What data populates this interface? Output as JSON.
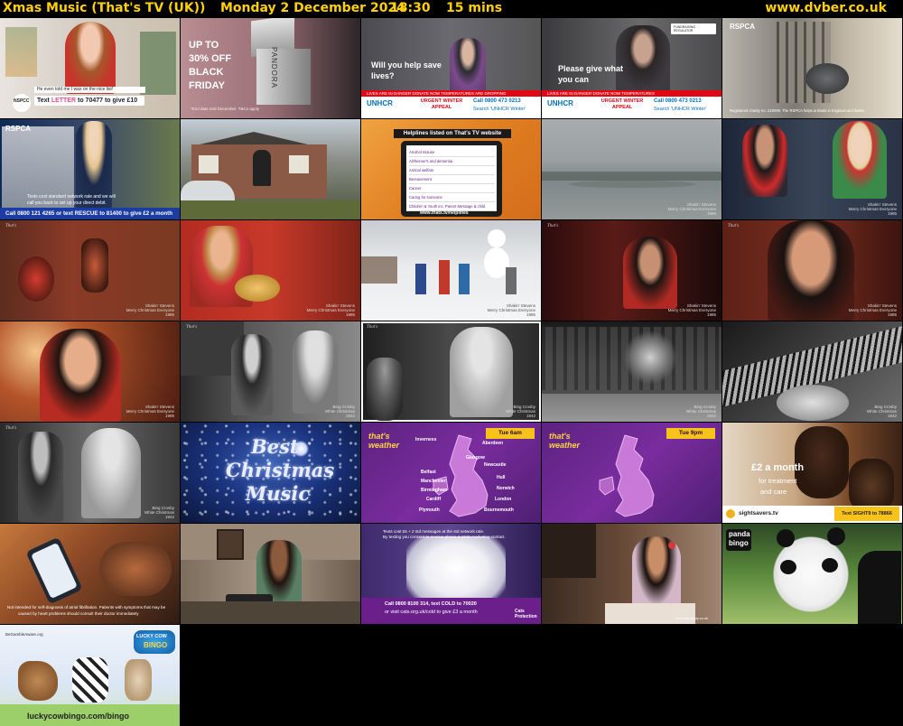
{
  "header": {
    "channel_title": "Xmas Music (That's TV (UK))",
    "date": "Monday 2 December 2024",
    "time": "18:30",
    "duration": "15 mins",
    "site": "www.dvber.co.uk"
  },
  "tiles": [
    {
      "id": "t01",
      "scene": "nrns-charity-ad",
      "texts": {
        "caption": "He even told me I was on the nice list!",
        "cta_pre": "Text ",
        "cta_key": "LETTER",
        "cta_mid": " to 70477 to give £10",
        "logo": "NSPCC"
      }
    },
    {
      "id": "t02",
      "scene": "pandora-black-friday",
      "texts": {
        "line1": "UP TO",
        "line2": "30% OFF",
        "line3": "BLACK",
        "line4": "FRIDAY",
        "brand": "PANDORA",
        "fine": "*End date 2nd December. T&Cs apply"
      }
    },
    {
      "id": "t03",
      "scene": "unhcr-appeal-girl",
      "texts": {
        "question": "Will you help save lives?",
        "ticker": "LIVES ARE IN DANGER   DONATE NOW   TEMPERATURES ARE DROPPING",
        "org": "UNHCR",
        "appeal": "URGENT WINTER APPEAL",
        "phone": "Call 0800 473 0213",
        "search": "Search 'UNHCR Winter'"
      }
    },
    {
      "id": "t04",
      "scene": "unhcr-appeal-boy",
      "texts": {
        "question": "Please give what you can",
        "ticker": "LIVES ARE IN DANGER   DONATE NOW   TEMPERATURES",
        "org": "UNHCR",
        "appeal": "URGENT WINTER APPEAL",
        "phone": "Call 0800 473 0213",
        "search": "Search 'UNHCR Winter'",
        "badge": "FUNDRAISING REGULATOR"
      }
    },
    {
      "id": "t05",
      "scene": "rspca-kennel",
      "texts": {
        "logo": "RSPCA",
        "fine": "Registered charity no. 219099. The RSPCA helps animals in England and Wales"
      }
    },
    {
      "id": "t06",
      "scene": "rspca-van",
      "texts": {
        "logo": "RSPCA",
        "small1": "Texts cost standard network rate and we will",
        "small2": "call you back to set up your direct debit.",
        "cta": "Call 0800 121 4265 or text RESCUE to 81400 to give £2 a month"
      }
    },
    {
      "id": "t07",
      "scene": "house-dog-walker",
      "texts": {}
    },
    {
      "id": "t08",
      "scene": "helplines-tablet",
      "texts": {
        "title": "Helplines listed on That's TV website",
        "items": [
          "Alcohol misuse",
          "Alzheimer's and dementia",
          "Animal welfare",
          "Bereavement",
          "Cancer",
          "Caring for someone",
          "Children & Youth inc. Parent Message & child"
        ],
        "url": "www.thats.tv/helplines"
      }
    },
    {
      "id": "t09",
      "scene": "lake-winter",
      "texts": {
        "credit1": "Shakin' Stevens",
        "credit2": "Merry Christmas Everyone",
        "credit3": "1985"
      }
    },
    {
      "id": "t10",
      "scene": "shakin-snow-couple",
      "texts": {
        "credit1": "Shakin' Stevens",
        "credit2": "Merry Christmas Everyone",
        "credit3": "1985"
      }
    },
    {
      "id": "t11",
      "scene": "elves-workshop",
      "texts": {
        "credit1": "Shakin' Stevens",
        "credit2": "Merry Christmas Everyone",
        "credit3": "1985"
      }
    },
    {
      "id": "t12",
      "scene": "boy-presents",
      "texts": {
        "credit1": "Shakin' Stevens",
        "credit2": "Merry Christmas Everyone",
        "credit3": "1985"
      }
    },
    {
      "id": "t13",
      "scene": "snowman-kids",
      "texts": {
        "credit1": "Shakin' Stevens",
        "credit2": "Merry Christmas Everyone",
        "credit3": "1985"
      }
    },
    {
      "id": "t14",
      "scene": "shakin-closeup-dark",
      "texts": {
        "credit1": "Shakin' Stevens",
        "credit2": "Merry Christmas Everyone",
        "credit3": "1985"
      }
    },
    {
      "id": "t15",
      "scene": "shakin-smile",
      "texts": {
        "credit1": "Shakin' Stevens",
        "credit2": "Merry Christmas Everyone",
        "credit3": "1985"
      }
    },
    {
      "id": "t16",
      "scene": "shakin-warm",
      "texts": {
        "credit1": "Shakin' Stevens",
        "credit2": "Merry Christmas Everyone",
        "credit3": "1985"
      }
    },
    {
      "id": "t17",
      "scene": "bing-piano",
      "texts": {
        "credit1": "Bing Crosby",
        "credit2": "White Christmas",
        "credit3": "1942"
      }
    },
    {
      "id": "t18",
      "scene": "bw-woman-window",
      "texts": {
        "credit1": "Bing Crosby",
        "credit2": "White Christmas",
        "credit3": "1942"
      }
    },
    {
      "id": "t19",
      "scene": "bw-snow-trees",
      "texts": {
        "credit1": "Bing Crosby",
        "credit2": "White Christmas",
        "credit3": "1942"
      }
    },
    {
      "id": "t20",
      "scene": "bw-piano-hands",
      "texts": {
        "credit1": "Bing Crosby",
        "credit2": "White Christmas",
        "credit3": "1942"
      }
    },
    {
      "id": "t21",
      "scene": "bw-couple",
      "texts": {
        "credit1": "Bing Crosby",
        "credit2": "White Christmas",
        "credit3": "1942"
      }
    },
    {
      "id": "t22",
      "scene": "best-christmas-music",
      "texts": {
        "line1": "Best",
        "line2": "Christmas",
        "line3": "Music"
      }
    },
    {
      "id": "t23",
      "scene": "weather-map-cities",
      "texts": {
        "logo1": "that's",
        "logo2": "weather",
        "when": "Tue 6am",
        "cities": [
          "Inverness",
          "Aberdeen",
          "Glasgow",
          "Newcastle",
          "Belfast",
          "Manchester",
          "Hull",
          "Birmingham",
          "Norwich",
          "Cardiff",
          "London",
          "Plymouth",
          "Bournemouth"
        ]
      }
    },
    {
      "id": "t24",
      "scene": "weather-map-plain",
      "texts": {
        "logo1": "that's",
        "logo2": "weather",
        "when": "Tue 9pm"
      }
    },
    {
      "id": "t25",
      "scene": "sightsavers",
      "texts": {
        "line1": "£2 a month",
        "line2": "for treatment",
        "line3": "and care",
        "site": "sightsavers.tv",
        "cta": "Text SIGHT9 to 78866"
      }
    },
    {
      "id": "t26",
      "scene": "phone-health-ad",
      "texts": {
        "fine1": "Not intended for self-diagnosis of atrial fibrillation. Patients with symptoms that may be",
        "fine2": "caused by heart problems should consult their doctor immediately"
      }
    },
    {
      "id": "t27",
      "scene": "woman-laptop-sofa",
      "texts": {}
    },
    {
      "id": "t28",
      "scene": "cats-protection",
      "texts": {
        "top1": "Texts cost £5 + 2 std messages at the std network rate.",
        "top2": "By texting you consent to receive phone & SMS marketing contact.",
        "line1": "Call 0800 8100 314, text COLD to 70020",
        "line2": "or visit cats.org.uk/cold to give £3 a month",
        "logo": "Cats Protection"
      }
    },
    {
      "id": "t29",
      "scene": "girl-reading",
      "texts": {
        "site": "wearedentsply.co.uk"
      }
    },
    {
      "id": "t30",
      "scene": "panda-bingo",
      "texts": {
        "logo1": "panda",
        "logo2": "bingo"
      }
    },
    {
      "id": "t31",
      "scene": "lucky-cow-bingo",
      "texts": {
        "gamble": "BeGambleAware.org",
        "logo1": "LUCKY COW",
        "logo2": "BINGO",
        "url": "luckycowbingo.com/bingo"
      }
    }
  ]
}
